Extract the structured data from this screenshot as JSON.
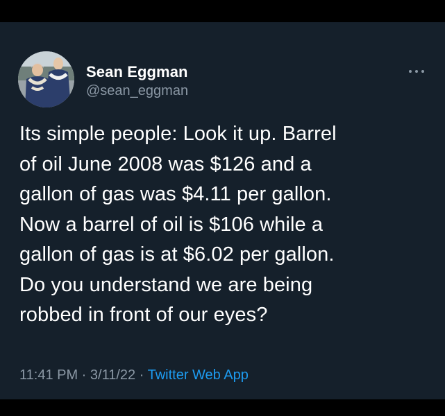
{
  "tweet": {
    "author": {
      "display_name": "Sean Eggman",
      "handle": "@sean_eggman",
      "avatar_icon": "profile-photo-two-people-with-leis"
    },
    "more_icon": "ellipsis-icon",
    "text": "Its simple people:  Look it up.  Barrel\nof oil June 2008 was $126 and a\ngallon of gas was $4.11 per gallon.\nNow a barrel of oil is $106 while a\ngallon of gas is at $6.02 per gallon.\nDo you understand we are being\nrobbed in front of our eyes?",
    "time": "11:41 PM",
    "separator": " · ",
    "date": "3/11/22",
    "source": "Twitter Web App"
  },
  "colors": {
    "background": "#15202b",
    "text": "#ffffff",
    "muted": "#8b98a5",
    "accent": "#1d9bf0"
  }
}
